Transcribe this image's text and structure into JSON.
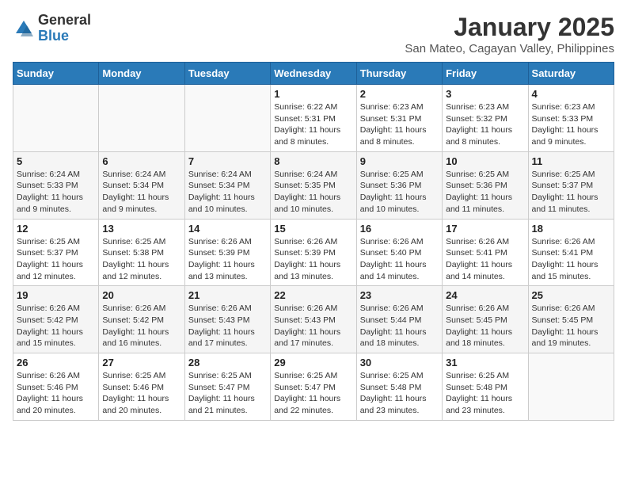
{
  "header": {
    "logo_general": "General",
    "logo_blue": "Blue",
    "month_title": "January 2025",
    "subtitle": "San Mateo, Cagayan Valley, Philippines"
  },
  "days_of_week": [
    "Sunday",
    "Monday",
    "Tuesday",
    "Wednesday",
    "Thursday",
    "Friday",
    "Saturday"
  ],
  "weeks": [
    [
      {
        "day": "",
        "sunrise": "",
        "sunset": "",
        "daylight": ""
      },
      {
        "day": "",
        "sunrise": "",
        "sunset": "",
        "daylight": ""
      },
      {
        "day": "",
        "sunrise": "",
        "sunset": "",
        "daylight": ""
      },
      {
        "day": "1",
        "sunrise": "Sunrise: 6:22 AM",
        "sunset": "Sunset: 5:31 PM",
        "daylight": "Daylight: 11 hours and 8 minutes."
      },
      {
        "day": "2",
        "sunrise": "Sunrise: 6:23 AM",
        "sunset": "Sunset: 5:31 PM",
        "daylight": "Daylight: 11 hours and 8 minutes."
      },
      {
        "day": "3",
        "sunrise": "Sunrise: 6:23 AM",
        "sunset": "Sunset: 5:32 PM",
        "daylight": "Daylight: 11 hours and 8 minutes."
      },
      {
        "day": "4",
        "sunrise": "Sunrise: 6:23 AM",
        "sunset": "Sunset: 5:33 PM",
        "daylight": "Daylight: 11 hours and 9 minutes."
      }
    ],
    [
      {
        "day": "5",
        "sunrise": "Sunrise: 6:24 AM",
        "sunset": "Sunset: 5:33 PM",
        "daylight": "Daylight: 11 hours and 9 minutes."
      },
      {
        "day": "6",
        "sunrise": "Sunrise: 6:24 AM",
        "sunset": "Sunset: 5:34 PM",
        "daylight": "Daylight: 11 hours and 9 minutes."
      },
      {
        "day": "7",
        "sunrise": "Sunrise: 6:24 AM",
        "sunset": "Sunset: 5:34 PM",
        "daylight": "Daylight: 11 hours and 10 minutes."
      },
      {
        "day": "8",
        "sunrise": "Sunrise: 6:24 AM",
        "sunset": "Sunset: 5:35 PM",
        "daylight": "Daylight: 11 hours and 10 minutes."
      },
      {
        "day": "9",
        "sunrise": "Sunrise: 6:25 AM",
        "sunset": "Sunset: 5:36 PM",
        "daylight": "Daylight: 11 hours and 10 minutes."
      },
      {
        "day": "10",
        "sunrise": "Sunrise: 6:25 AM",
        "sunset": "Sunset: 5:36 PM",
        "daylight": "Daylight: 11 hours and 11 minutes."
      },
      {
        "day": "11",
        "sunrise": "Sunrise: 6:25 AM",
        "sunset": "Sunset: 5:37 PM",
        "daylight": "Daylight: 11 hours and 11 minutes."
      }
    ],
    [
      {
        "day": "12",
        "sunrise": "Sunrise: 6:25 AM",
        "sunset": "Sunset: 5:37 PM",
        "daylight": "Daylight: 11 hours and 12 minutes."
      },
      {
        "day": "13",
        "sunrise": "Sunrise: 6:25 AM",
        "sunset": "Sunset: 5:38 PM",
        "daylight": "Daylight: 11 hours and 12 minutes."
      },
      {
        "day": "14",
        "sunrise": "Sunrise: 6:26 AM",
        "sunset": "Sunset: 5:39 PM",
        "daylight": "Daylight: 11 hours and 13 minutes."
      },
      {
        "day": "15",
        "sunrise": "Sunrise: 6:26 AM",
        "sunset": "Sunset: 5:39 PM",
        "daylight": "Daylight: 11 hours and 13 minutes."
      },
      {
        "day": "16",
        "sunrise": "Sunrise: 6:26 AM",
        "sunset": "Sunset: 5:40 PM",
        "daylight": "Daylight: 11 hours and 14 minutes."
      },
      {
        "day": "17",
        "sunrise": "Sunrise: 6:26 AM",
        "sunset": "Sunset: 5:41 PM",
        "daylight": "Daylight: 11 hours and 14 minutes."
      },
      {
        "day": "18",
        "sunrise": "Sunrise: 6:26 AM",
        "sunset": "Sunset: 5:41 PM",
        "daylight": "Daylight: 11 hours and 15 minutes."
      }
    ],
    [
      {
        "day": "19",
        "sunrise": "Sunrise: 6:26 AM",
        "sunset": "Sunset: 5:42 PM",
        "daylight": "Daylight: 11 hours and 15 minutes."
      },
      {
        "day": "20",
        "sunrise": "Sunrise: 6:26 AM",
        "sunset": "Sunset: 5:42 PM",
        "daylight": "Daylight: 11 hours and 16 minutes."
      },
      {
        "day": "21",
        "sunrise": "Sunrise: 6:26 AM",
        "sunset": "Sunset: 5:43 PM",
        "daylight": "Daylight: 11 hours and 17 minutes."
      },
      {
        "day": "22",
        "sunrise": "Sunrise: 6:26 AM",
        "sunset": "Sunset: 5:43 PM",
        "daylight": "Daylight: 11 hours and 17 minutes."
      },
      {
        "day": "23",
        "sunrise": "Sunrise: 6:26 AM",
        "sunset": "Sunset: 5:44 PM",
        "daylight": "Daylight: 11 hours and 18 minutes."
      },
      {
        "day": "24",
        "sunrise": "Sunrise: 6:26 AM",
        "sunset": "Sunset: 5:45 PM",
        "daylight": "Daylight: 11 hours and 18 minutes."
      },
      {
        "day": "25",
        "sunrise": "Sunrise: 6:26 AM",
        "sunset": "Sunset: 5:45 PM",
        "daylight": "Daylight: 11 hours and 19 minutes."
      }
    ],
    [
      {
        "day": "26",
        "sunrise": "Sunrise: 6:26 AM",
        "sunset": "Sunset: 5:46 PM",
        "daylight": "Daylight: 11 hours and 20 minutes."
      },
      {
        "day": "27",
        "sunrise": "Sunrise: 6:25 AM",
        "sunset": "Sunset: 5:46 PM",
        "daylight": "Daylight: 11 hours and 20 minutes."
      },
      {
        "day": "28",
        "sunrise": "Sunrise: 6:25 AM",
        "sunset": "Sunset: 5:47 PM",
        "daylight": "Daylight: 11 hours and 21 minutes."
      },
      {
        "day": "29",
        "sunrise": "Sunrise: 6:25 AM",
        "sunset": "Sunset: 5:47 PM",
        "daylight": "Daylight: 11 hours and 22 minutes."
      },
      {
        "day": "30",
        "sunrise": "Sunrise: 6:25 AM",
        "sunset": "Sunset: 5:48 PM",
        "daylight": "Daylight: 11 hours and 23 minutes."
      },
      {
        "day": "31",
        "sunrise": "Sunrise: 6:25 AM",
        "sunset": "Sunset: 5:48 PM",
        "daylight": "Daylight: 11 hours and 23 minutes."
      },
      {
        "day": "",
        "sunrise": "",
        "sunset": "",
        "daylight": ""
      }
    ]
  ]
}
